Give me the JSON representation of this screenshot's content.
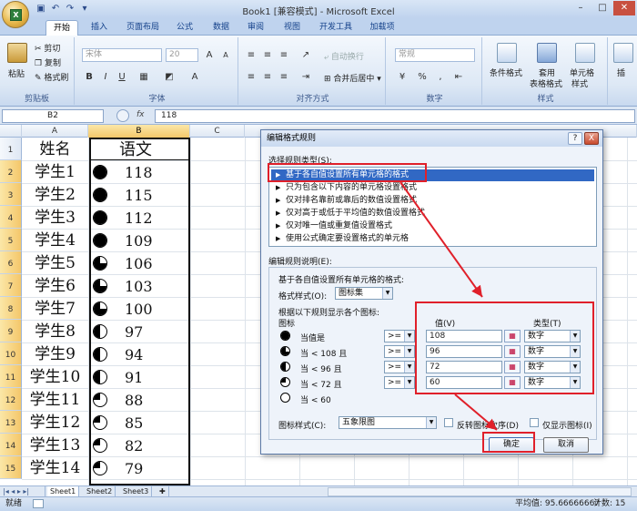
{
  "window": {
    "title": "Book1 [兼容模式] - Microsoft Excel"
  },
  "qat": {
    "save_icon": "save-icon",
    "undo_icon": "undo-icon",
    "redo_icon": "redo-icon"
  },
  "ribbon": {
    "tabs": [
      "开始",
      "插入",
      "页面布局",
      "公式",
      "数据",
      "审阅",
      "视图",
      "开发工具",
      "加载项"
    ],
    "active_tab": "开始",
    "clipboard": {
      "paste": "粘贴",
      "cut": "剪切",
      "copy": "复制",
      "format_painter": "格式刷",
      "label": "剪贴板"
    },
    "font": {
      "name": "宋体",
      "size": "20",
      "label": "字体",
      "bold": "B",
      "italic": "I",
      "underline": "U",
      "grow": "A",
      "shrink": "A",
      "color_a": "A"
    },
    "alignment": {
      "wrap": "自动换行",
      "merge": "合并后居中",
      "label": "对齐方式"
    },
    "number": {
      "format": "常规",
      "percent": "%",
      "comma": ",",
      "label": "数字"
    },
    "styles": {
      "conditional": "条件格式",
      "table1": "套用",
      "table2": "表格格式",
      "cell1": "单元格",
      "cell2": "样式",
      "label": "样式"
    },
    "cells": {
      "insert": "插"
    }
  },
  "formula_bar": {
    "name_box": "B2",
    "fx": "fx",
    "value": "118"
  },
  "columns": [
    "A",
    "B",
    "C"
  ],
  "rows": [
    {
      "n": "1",
      "a": "姓名",
      "b": "语文",
      "icon": ""
    },
    {
      "n": "2",
      "a": "学生1",
      "b": "118",
      "icon": "full"
    },
    {
      "n": "3",
      "a": "学生2",
      "b": "115",
      "icon": "full"
    },
    {
      "n": "4",
      "a": "学生3",
      "b": "112",
      "icon": "full"
    },
    {
      "n": "5",
      "a": "学生4",
      "b": "109",
      "icon": "full"
    },
    {
      "n": "6",
      "a": "学生5",
      "b": "106",
      "icon": "three-quarter"
    },
    {
      "n": "7",
      "a": "学生6",
      "b": "103",
      "icon": "three-quarter"
    },
    {
      "n": "8",
      "a": "学生7",
      "b": "100",
      "icon": "three-quarter"
    },
    {
      "n": "9",
      "a": "学生8",
      "b": "97",
      "icon": "half"
    },
    {
      "n": "10",
      "a": "学生9",
      "b": "94",
      "icon": "half"
    },
    {
      "n": "11",
      "a": "学生10",
      "b": "91",
      "icon": "half"
    },
    {
      "n": "12",
      "a": "学生11",
      "b": "88",
      "icon": "quarter"
    },
    {
      "n": "13",
      "a": "学生12",
      "b": "85",
      "icon": "quarter"
    },
    {
      "n": "14",
      "a": "学生13",
      "b": "82",
      "icon": "quarter"
    },
    {
      "n": "15",
      "a": "学生14",
      "b": "79",
      "icon": "quarter"
    }
  ],
  "dialog": {
    "title": "编辑格式规则",
    "help": "?",
    "close": "X",
    "select_type_label": "选择规则类型(S):",
    "rule_types": [
      "基于各自值设置所有单元格的格式",
      "只为包含以下内容的单元格设置格式",
      "仅对排名靠前或靠后的数值设置格式",
      "仅对高于或低于平均值的数值设置格式",
      "仅对唯一值或重复值设置格式",
      "使用公式确定要设置格式的单元格"
    ],
    "edit_desc_label": "编辑规则说明(E):",
    "desc_title": "基于各自值设置所有单元格的格式:",
    "format_style_label": "格式样式(O):",
    "format_style_value": "图标集",
    "show_each_label": "根据以下规则显示各个图标:",
    "icon_header": "图标",
    "value_header": "值(V)",
    "type_header": "类型(T)",
    "rules": [
      {
        "label": "当值是",
        "op": ">=",
        "value": "108",
        "type": "数字",
        "icon": "full"
      },
      {
        "label": "当 < 108 且",
        "op": ">=",
        "value": "96",
        "type": "数字",
        "icon": "three-quarter"
      },
      {
        "label": "当 < 96 且",
        "op": ">=",
        "value": "72",
        "type": "数字",
        "icon": "half"
      },
      {
        "label": "当 < 72 且",
        "op": ">=",
        "value": "60",
        "type": "数字",
        "icon": "quarter"
      },
      {
        "label": "当 < 60",
        "op": "",
        "value": "",
        "type": "",
        "icon": "empty"
      }
    ],
    "icon_style_label": "图标样式(C):",
    "icon_style_value": "五象限图",
    "reverse_label": "反转图标次序(D)",
    "show_icon_only_label": "仅显示图标(I)",
    "ok": "确定",
    "cancel": "取消"
  },
  "sheets": [
    "Sheet1",
    "Sheet2",
    "Sheet3"
  ],
  "status": {
    "ready": "就绪",
    "average": "平均值: 95.66666667",
    "count": "计数: 15"
  }
}
